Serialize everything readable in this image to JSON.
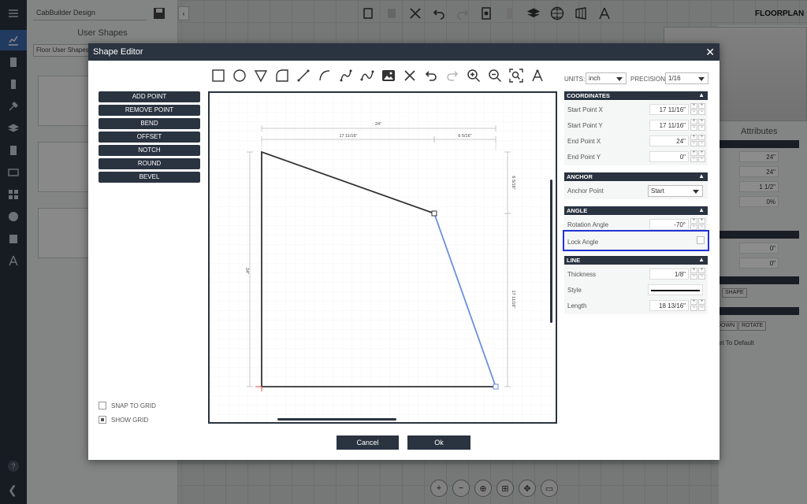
{
  "app": {
    "project_name": "CabBuilder Design",
    "user_shapes_title": "User Shapes",
    "shape_category": "Floor User Shapes",
    "view_label": "FLOORPLAN",
    "attributes_label": "Attributes",
    "right_panel_values": [
      "24\"",
      "24\"",
      "1 1/2\"",
      "0%",
      "0\"",
      "0\""
    ],
    "right_panel_buttons": [
      "SHAPE",
      "DOWN",
      "ROTATE"
    ],
    "reset_label": "et To Default"
  },
  "modal": {
    "title": "Shape Editor",
    "close": "✕",
    "operations": [
      "ADD POINT",
      "REMOVE POINT",
      "BEND",
      "OFFSET",
      "NOTCH",
      "ROUND",
      "BEVEL"
    ],
    "snap_to_grid": "SNAP TO GRID",
    "show_grid": "SHOW GRID",
    "snap_checked": false,
    "grid_checked": true,
    "cancel": "Cancel",
    "ok": "Ok",
    "units_label": "UNITS:",
    "units_value": "inch",
    "precision_label": "PRECISION:",
    "precision_value": "1/16",
    "coordinates": {
      "header": "COORDINATES",
      "start_x_label": "Start Point X",
      "start_x": "17 11/16\"",
      "start_y_label": "Start Point Y",
      "start_y": "17 11/16\"",
      "end_x_label": "End Point X",
      "end_x": "24\"",
      "end_y_label": "End Point Y",
      "end_y": "0\""
    },
    "anchor": {
      "header": "ANCHOR",
      "label": "Anchor Point",
      "value": "Start"
    },
    "angle": {
      "header": "ANGLE",
      "rotation_label": "Rotation Angle",
      "rotation": "-70°",
      "lock_label": "Lock Angle",
      "lock_checked": false
    },
    "line": {
      "header": "LINE",
      "thickness_label": "Thickness",
      "thickness": "1/8\"",
      "style_label": "Style",
      "length_label": "Length",
      "length": "18 13/16\""
    },
    "dimensions": {
      "top_total": "24\"",
      "top_left": "17 11/16\"",
      "top_right": "6 5/16\"",
      "left_total": "24\"",
      "right_top": "6 5/16\"",
      "right_bottom": "17 11/16\""
    },
    "accent_color": "#2234d4",
    "selected_line_color": "#6b8fe0",
    "header_color": "#2a3340"
  }
}
